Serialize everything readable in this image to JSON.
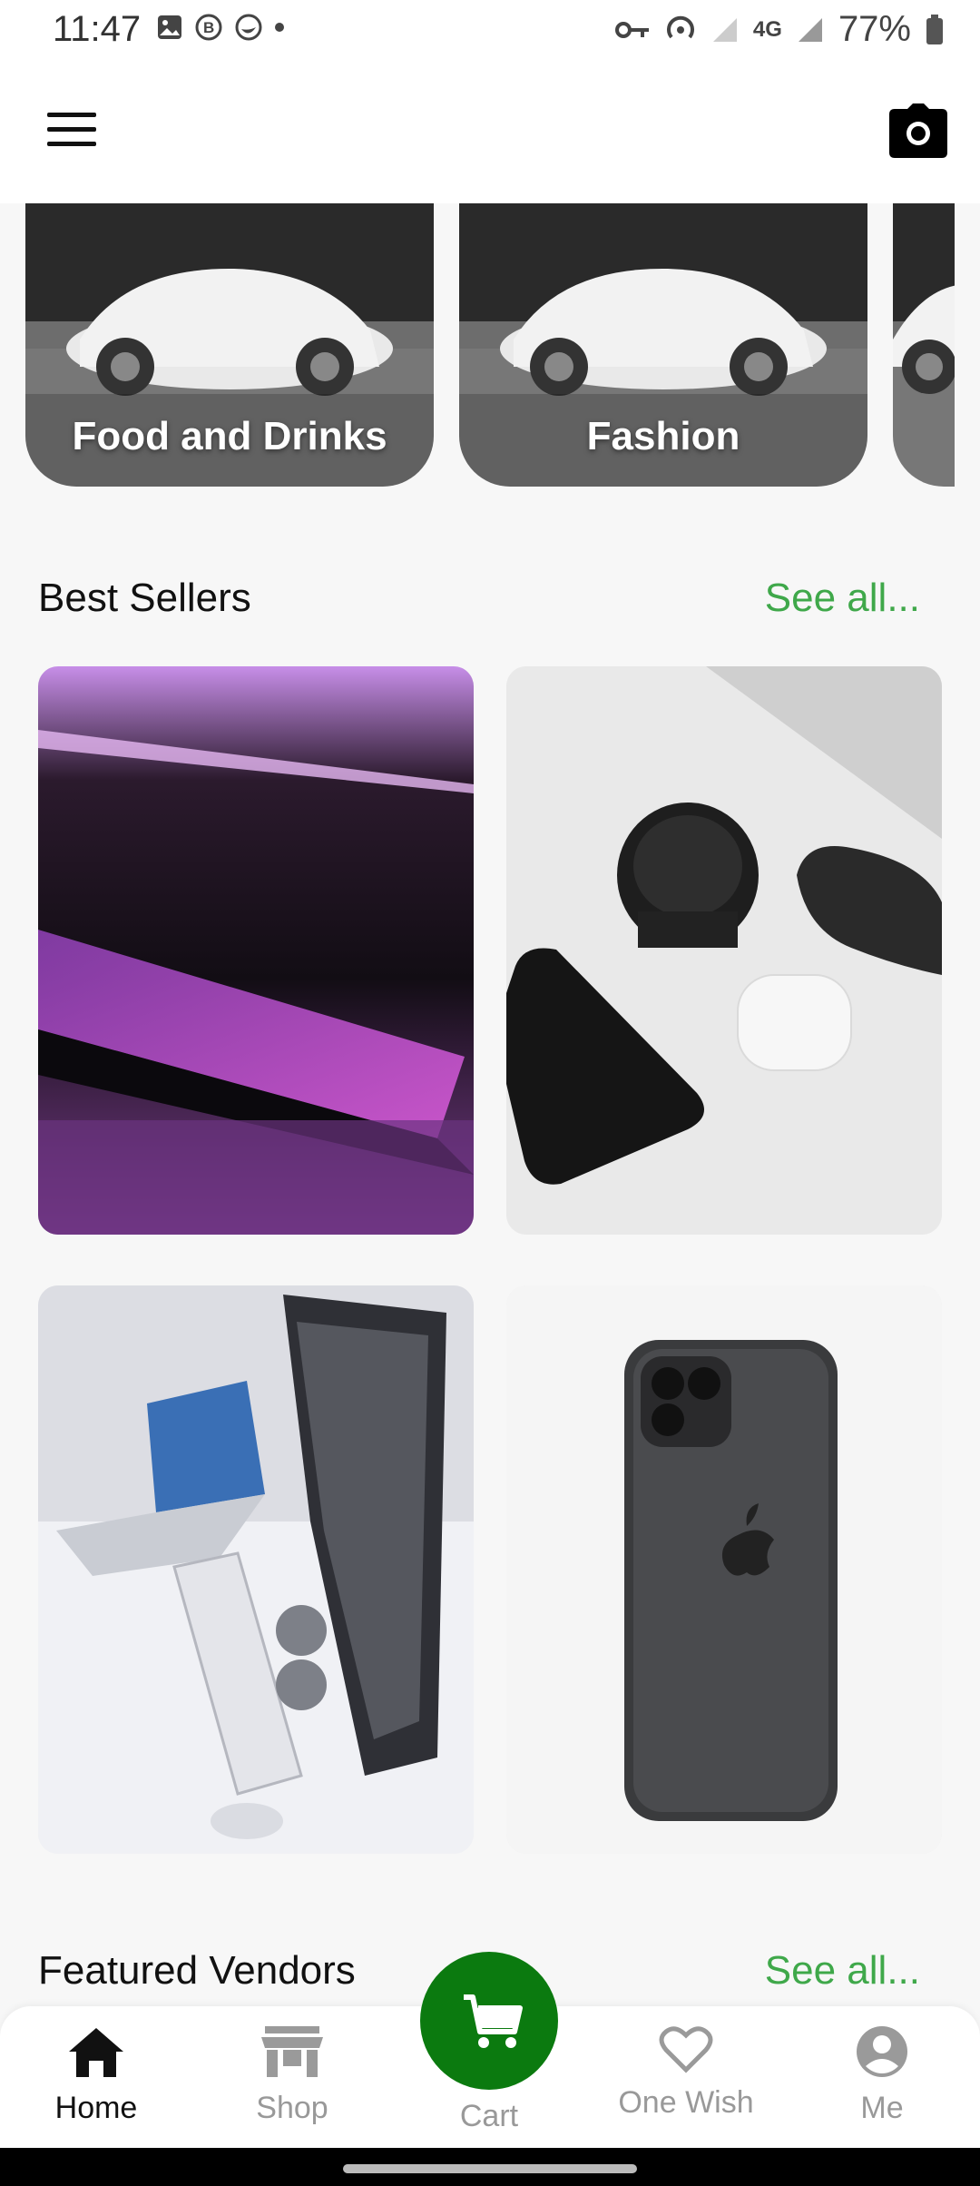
{
  "status": {
    "time": "11:47",
    "battery": "77%",
    "network": "4G"
  },
  "appbar": {
    "menu_icon": "hamburger-menu-icon",
    "camera_icon": "camera-icon"
  },
  "categories": [
    {
      "label": "Food and Drinks"
    },
    {
      "label": "Fashion"
    },
    {
      "label": ""
    }
  ],
  "best_sellers": {
    "title": "Best Sellers",
    "see_all": "See all..."
  },
  "featured_vendors": {
    "title": "Featured Vendors",
    "see_all": "See all..."
  },
  "bottom_nav": {
    "home": "Home",
    "shop": "Shop",
    "cart": "Cart",
    "wish": "One Wish",
    "me": "Me"
  },
  "colors": {
    "accent": "#3fa84a",
    "cart_fab": "#0b7a0f"
  }
}
